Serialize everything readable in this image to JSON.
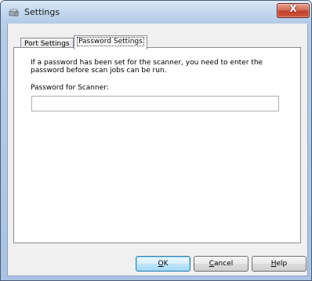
{
  "window": {
    "title": "Settings",
    "close_glyph": "X",
    "title_icon": "settings-scanner-icon"
  },
  "tabs": [
    {
      "label": "Port Settings",
      "active": false
    },
    {
      "label": "Password Settings",
      "active": true
    }
  ],
  "password_tab": {
    "description_line1": "If a password has been set for the scanner, you need to enter the",
    "description_line2": "password before scan jobs can be run.",
    "field_label": "Password for Scanner:",
    "field_value": ""
  },
  "buttons": {
    "ok": "OK",
    "cancel": "Cancel",
    "help": "Help"
  },
  "colors": {
    "close_button": "#c7442e",
    "default_button_border": "#3c7fb1",
    "panel_background": "#f0f0f0"
  }
}
